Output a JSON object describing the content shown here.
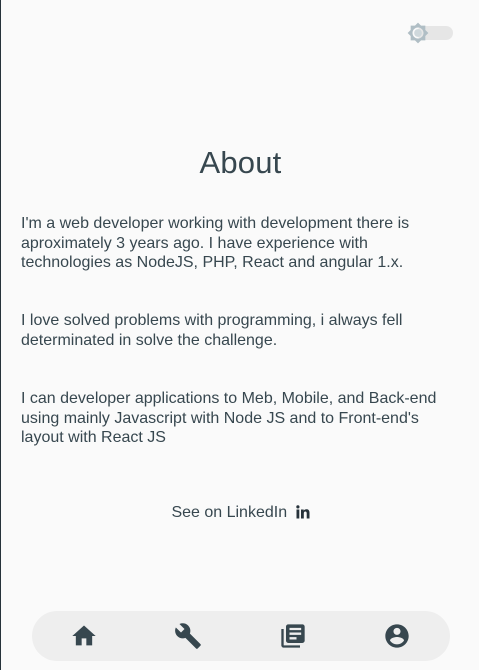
{
  "header": {
    "theme_toggle": {
      "state": "light",
      "icon": "sun-icon"
    }
  },
  "main": {
    "title": "About",
    "paragraphs": [
      "I'm a web developer working with development there is aproximately 3 years ago. I have experience with technologies as NodeJS, PHP, React and angular 1.x.",
      "I love solved problems with programming, i always fell determinated in solve the challenge.",
      "I can developer applications to Meb, Mobile, and Back-end using mainly Javascript with Node JS and to Front-end's layout with React JS"
    ],
    "linkedin": {
      "label": "See on LinkedIn",
      "icon": "linkedin-icon"
    }
  },
  "bottom_nav": {
    "items": [
      {
        "icon": "home-icon"
      },
      {
        "icon": "wrench-icon"
      },
      {
        "icon": "library-books-icon"
      },
      {
        "icon": "account-circle-icon"
      }
    ]
  },
  "colors": {
    "background": "#fafafa",
    "text": "#37474f",
    "nav_background": "#eeeeee",
    "toggle_track": "#e6e6e6",
    "toggle_thumb": "#b0bec5"
  }
}
